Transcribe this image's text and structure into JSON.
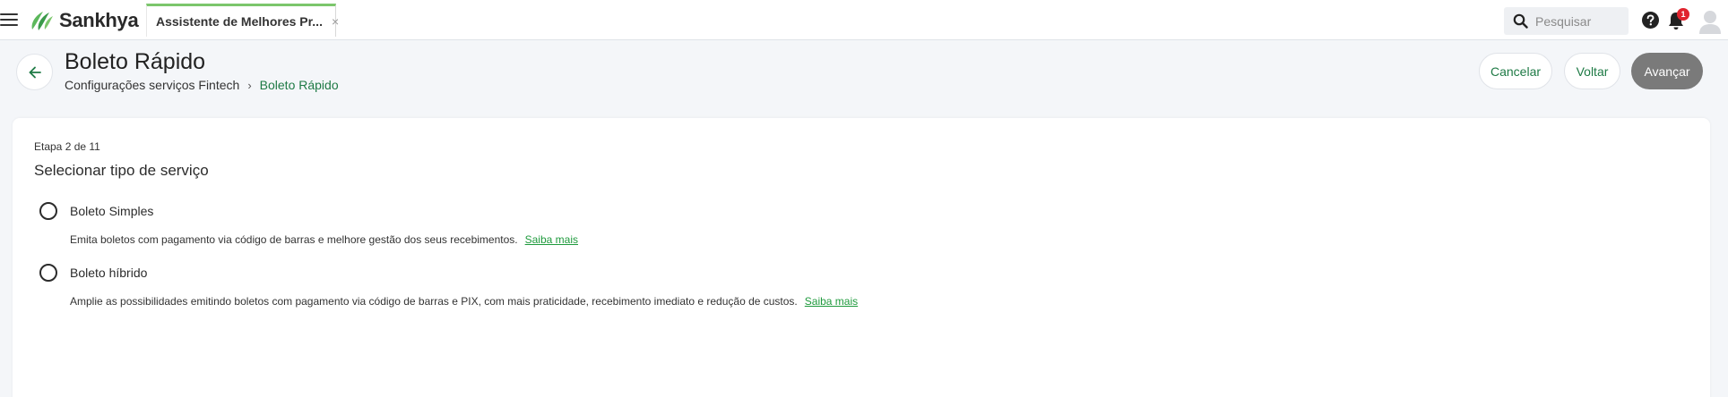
{
  "app": {
    "brand": "Sankhya",
    "tab_label": "Assistente de Melhores Pr...",
    "tab_close": "×"
  },
  "search": {
    "placeholder": "Pesquisar"
  },
  "notifications": {
    "count": "1"
  },
  "header": {
    "title": "Boleto Rápido",
    "breadcrumb_root": "Configurações serviços Fintech",
    "breadcrumb_sep": "›",
    "breadcrumb_current": "Boleto Rápido"
  },
  "actions": {
    "cancel": "Cancelar",
    "back": "Voltar",
    "next": "Avançar"
  },
  "wizard": {
    "step": "Etapa 2 de 11",
    "section_title": "Selecionar tipo de serviço",
    "options": [
      {
        "label": "Boleto Simples",
        "description": "Emita boletos com pagamento via código de barras e melhore gestão dos seus recebimentos.",
        "link": "Saiba mais"
      },
      {
        "label": "Boleto híbrido",
        "description": "Amplie as possibilidades emitindo boletos com pagamento via código de barras e PIX, com mais praticidade, recebimento imediato e redução de custos.",
        "link": "Saiba mais"
      }
    ]
  },
  "colors": {
    "accent_green": "#1e7a45",
    "link_green": "#1e9a3c",
    "tab_indicator": "#7cc66c",
    "primary_disabled": "#7a7a7a",
    "badge_red": "#e0242e"
  },
  "icons": [
    "hamburger-icon",
    "sankhya-logo",
    "search-icon",
    "help-icon",
    "bell-icon",
    "avatar-icon",
    "arrow-left-icon",
    "chevron-right-icon"
  ]
}
